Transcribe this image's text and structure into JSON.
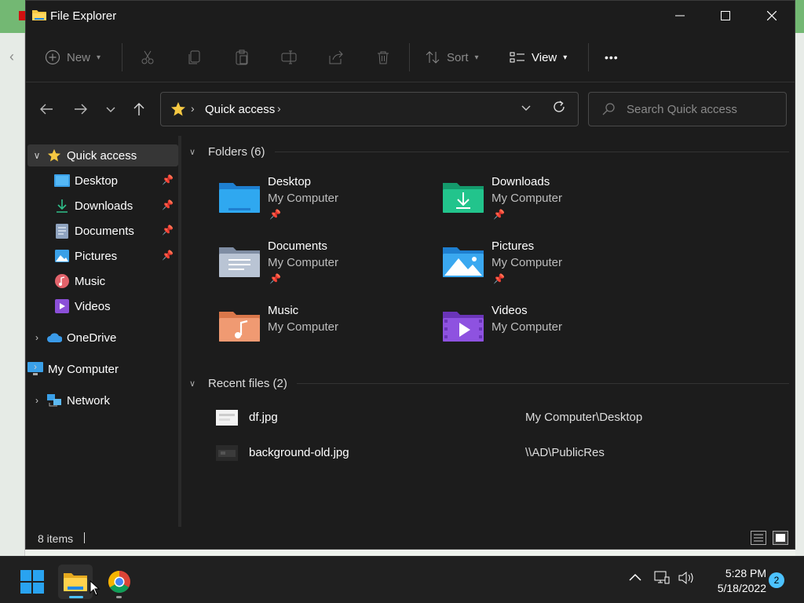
{
  "window": {
    "title": "File Explorer"
  },
  "toolbar": {
    "new_label": "New",
    "sort_label": "Sort",
    "view_label": "View",
    "more_label": "•••"
  },
  "address": {
    "crumb": "Quick access"
  },
  "search": {
    "placeholder": "Search Quick access"
  },
  "sidebar": {
    "quick_access": "Quick access",
    "items": [
      {
        "label": "Desktop",
        "icon": "desktop-icon",
        "pinned": true
      },
      {
        "label": "Downloads",
        "icon": "download-icon",
        "pinned": true
      },
      {
        "label": "Documents",
        "icon": "documents-icon",
        "pinned": true
      },
      {
        "label": "Pictures",
        "icon": "pictures-icon",
        "pinned": true
      },
      {
        "label": "Music",
        "icon": "music-icon",
        "pinned": false
      },
      {
        "label": "Videos",
        "icon": "videos-icon",
        "pinned": false
      }
    ],
    "onedrive": "OneDrive",
    "my_computer": "My Computer",
    "network": "Network"
  },
  "folders": {
    "header": "Folders (6)",
    "items": [
      {
        "name": "Desktop",
        "location": "My Computer",
        "pinned": true
      },
      {
        "name": "Downloads",
        "location": "My Computer",
        "pinned": true
      },
      {
        "name": "Documents",
        "location": "My Computer",
        "pinned": true
      },
      {
        "name": "Pictures",
        "location": "My Computer",
        "pinned": true
      },
      {
        "name": "Music",
        "location": "My Computer",
        "pinned": false
      },
      {
        "name": "Videos",
        "location": "My Computer",
        "pinned": false
      }
    ]
  },
  "recent": {
    "header": "Recent files (2)",
    "items": [
      {
        "name": "df.jpg",
        "path": "My Computer\\Desktop"
      },
      {
        "name": "background-old.jpg",
        "path": "\\\\AD\\PublicRes"
      }
    ]
  },
  "status": {
    "count": "8 items"
  },
  "taskbar": {
    "time": "5:28 PM",
    "date": "5/18/2022",
    "notifications": "2"
  },
  "colors": {
    "window_bg": "#1c1c1c",
    "accent": "#4cc2ff",
    "folder_yellow": "#f5c842"
  }
}
